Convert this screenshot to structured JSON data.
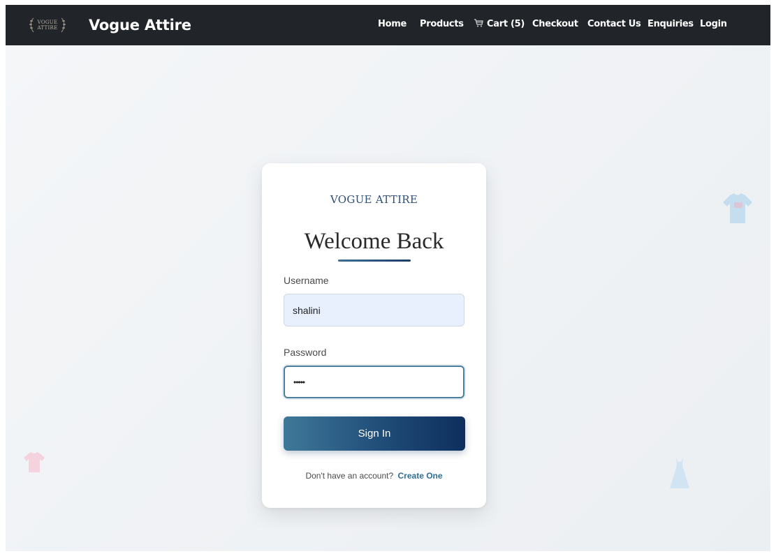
{
  "header": {
    "logo": {
      "line1": "VOGUE",
      "line2": "ATTIRE"
    },
    "brand": "Vogue Attire",
    "nav": [
      {
        "label": "Home"
      },
      {
        "label": "Products"
      },
      {
        "label": "Cart (5)",
        "icon": "cart-icon"
      },
      {
        "label": "Checkout"
      },
      {
        "label": "Contact Us"
      },
      {
        "label": "Enquiries"
      },
      {
        "label": "Login"
      }
    ]
  },
  "card": {
    "brand": "VOGUE ATTIRE",
    "title": "Welcome Back",
    "username_label": "Username",
    "username_value": "shalini",
    "password_label": "Password",
    "password_value": "•••••",
    "signin_label": "Sign In",
    "signup_prompt": "Don't have an account?",
    "signup_link": "Create One"
  },
  "colors": {
    "navbar": "#212529",
    "accent": "#2f4f76",
    "button_start": "#3f7899",
    "button_end": "#0f2f5d"
  },
  "decorations": [
    "shirt-icon",
    "tshirt-icon",
    "dress-icon"
  ]
}
